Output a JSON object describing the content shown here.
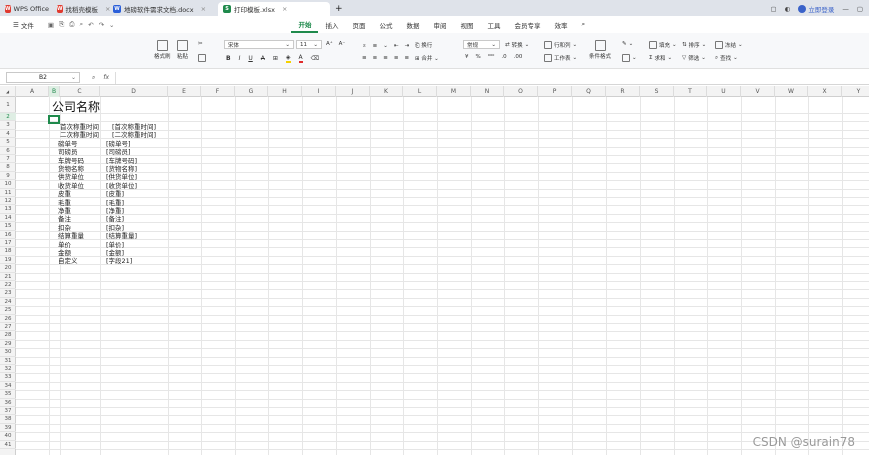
{
  "titlebar": {
    "tabs": [
      {
        "label": "WPS Office",
        "icon": "wps-logo-icon",
        "color": "#e03a2f"
      },
      {
        "label": "找稻壳模板",
        "icon": "docer-icon",
        "color": "#e03a2f"
      },
      {
        "label": "地磅软件需求文档.docx",
        "icon": "word-doc-icon",
        "color": "#2b5fd9"
      },
      {
        "label": "打印模板.xlsx",
        "icon": "sheet-icon",
        "color": "#1f8a4c",
        "active": true
      }
    ],
    "new_tab": "+",
    "login": "立即登录"
  },
  "menubar": {
    "file": "文件",
    "items": [
      "开始",
      "插入",
      "页面",
      "公式",
      "数据",
      "审阅",
      "视图",
      "工具",
      "会员专享",
      "效率"
    ],
    "active": "开始"
  },
  "ribbon": {
    "format_painter": "格式刷",
    "paste": "粘贴",
    "font_name": "宋体",
    "font_size": "11",
    "wrap": "换行",
    "merge": "合并",
    "number_format": "常规",
    "convert": "转换",
    "rows_cols": "行和列",
    "worksheet": "工作表",
    "cond_format": "条件格式",
    "fill": "填充",
    "sort": "排序",
    "freeze": "冻结",
    "sum": "求和",
    "filter": "筛选",
    "find": "查找"
  },
  "formula": {
    "namebox": "B2",
    "fx": "fx"
  },
  "sheet": {
    "columns": [
      "A",
      "B",
      "C",
      "D",
      "E",
      "F",
      "G",
      "H",
      "I",
      "J",
      "K",
      "L",
      "M",
      "N",
      "O",
      "P",
      "Q",
      "R",
      "S",
      "T",
      "U",
      "V",
      "W",
      "X",
      "Y"
    ],
    "row_count": 41,
    "company": "公司名称",
    "labels": [
      "首次称重时间",
      "二次称重时间",
      "磅单号",
      "司磅员",
      "车牌号码",
      "货物名称",
      "供货单位",
      "收货单位",
      "皮重",
      "毛重",
      "净重",
      "备注",
      "扣杂",
      "结算重量",
      "单价",
      "金额",
      "自定义"
    ],
    "values": [
      "[首次称重时间]",
      "[二次称重时间]",
      "[磅单号]",
      "[司磅员]",
      "[车牌号码]",
      "[货物名称]",
      "[供货单位]",
      "[收货单位]",
      "[皮重]",
      "[毛重]",
      "[净重]",
      "[备注]",
      "[扣杂]",
      "[结算重量]",
      "[单价]",
      "[金额]",
      "[字段21]"
    ]
  },
  "watermark": "CSDN @surain78"
}
